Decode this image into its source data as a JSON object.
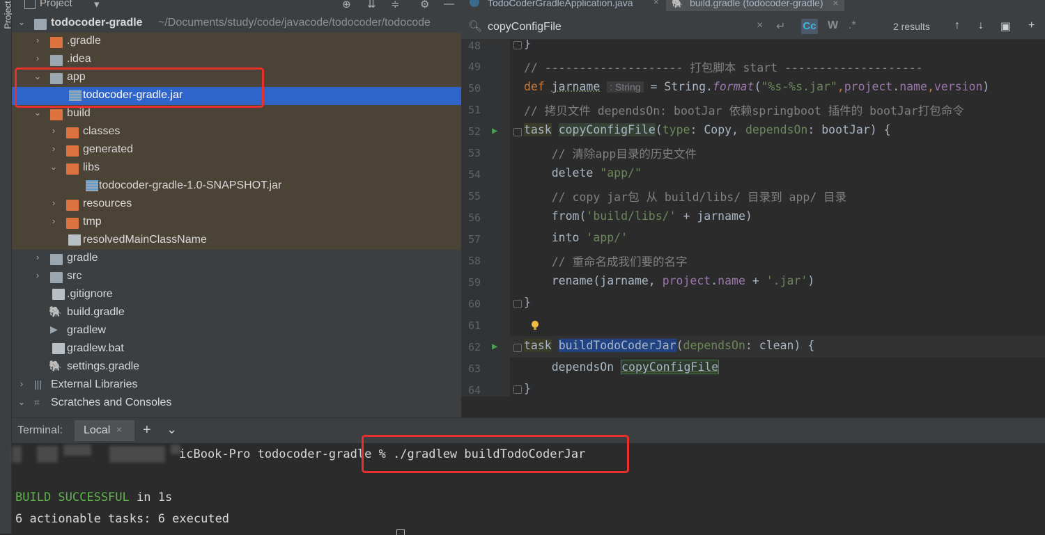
{
  "side_strip": {
    "label": "Project"
  },
  "project": {
    "header_title": "Project",
    "tree": [
      {
        "label": "todocoder-gradle",
        "path": "~/Documents/study/code/javacode/todocoder/todocode"
      },
      {
        "label": ".gradle"
      },
      {
        "label": ".idea"
      },
      {
        "label": "app"
      },
      {
        "label": "todocoder-gradle.jar"
      },
      {
        "label": "build"
      },
      {
        "label": "classes"
      },
      {
        "label": "generated"
      },
      {
        "label": "libs"
      },
      {
        "label": "todocoder-gradle-1.0-SNAPSHOT.jar"
      },
      {
        "label": "resources"
      },
      {
        "label": "tmp"
      },
      {
        "label": "resolvedMainClassName"
      },
      {
        "label": "gradle"
      },
      {
        "label": "src"
      },
      {
        "label": ".gitignore"
      },
      {
        "label": "build.gradle"
      },
      {
        "label": "gradlew"
      },
      {
        "label": "gradlew.bat"
      },
      {
        "label": "settings.gradle"
      },
      {
        "label": "External Libraries"
      },
      {
        "label": "Scratches and Consoles"
      }
    ]
  },
  "editor_tabs": [
    {
      "label": "TodoCoderGradleApplication.java"
    },
    {
      "label": "build.gradle (todocoder-gradle)"
    }
  ],
  "find": {
    "query": "copyConfigFile",
    "results": "2 results",
    "case_label": "Cc",
    "word_label": "W",
    "regex_label": ".*"
  },
  "editor": {
    "line_numbers": [
      "48",
      "49",
      "50",
      "51",
      "52",
      "53",
      "54",
      "55",
      "56",
      "57",
      "58",
      "59",
      "60",
      "61",
      "62",
      "63",
      "64"
    ],
    "l48": "}",
    "l49": "// -------------------- 打包脚本 start --------------------",
    "l50_kw": "def",
    "l50_var": "jarname",
    "l50_hint": ": String",
    "l50_eq": " = String.",
    "l50_fn": "format",
    "l50_open": "(",
    "l50_str": "\"%s-%s.jar\"",
    "l50_c1": ",",
    "l50_p1": "project",
    "l50_dot": ".",
    "l50_p2": "name",
    "l50_c2": ",",
    "l50_p3": "version",
    "l50_close": ")",
    "l51": "// 拷贝文件 dependsOn: bootJar 依赖springboot 插件的 bootJar打包命令",
    "l52_task": "task",
    "l52_name": "copyConfigFile",
    "l52_open": "(",
    "l52_type": "type",
    "l52_mid": ": Copy, ",
    "l52_dep": "dependsOn",
    "l52_end": ": bootJar) {",
    "l53": "    // 清除app目录的历史文件",
    "l54_a": "    delete ",
    "l54_s": "\"app/\"",
    "l55": "    // copy jar包 从 build/libs/ 目录到 app/ 目录",
    "l56_a": "    from(",
    "l56_s": "'build/libs/'",
    "l56_b": " + jarname)",
    "l57_a": "    into ",
    "l57_s": "'app/'",
    "l58": "    // 重命名成我们要的名字",
    "l59_a": "    rename(jarname, ",
    "l59_p1": "project",
    "l59_dot": ".",
    "l59_p2": "name",
    "l59_b": " + ",
    "l59_s": "'.jar'",
    "l59_c": ")",
    "l60": "}",
    "l62_task": "task",
    "l62_name": "buildTodoCoderJar",
    "l62_open": "(",
    "l62_dep": "dependsOn",
    "l62_end": ": clean) {",
    "l63_a": "    dependsOn ",
    "l63_ref": "copyConfigFile",
    "l64": "}"
  },
  "terminal": {
    "title": "Terminal:",
    "tab": "Local",
    "prompt": "icBook-Pro todocoder-gradle % ./gradlew buildTodoCoderJar",
    "build_ok": "BUILD SUCCESSFUL",
    "build_rest": " in 1s",
    "tasks": "6 actionable tasks: 6 executed"
  }
}
